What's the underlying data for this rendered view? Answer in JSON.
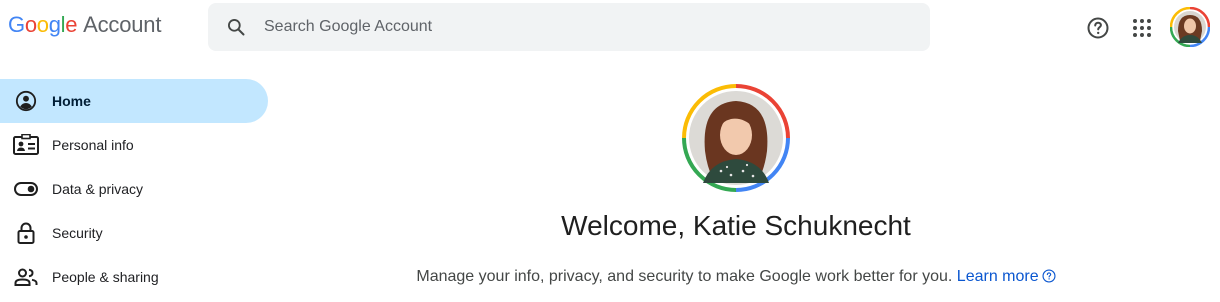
{
  "header": {
    "logo_brand": "Google",
    "logo_product": "Account",
    "search_placeholder": "Search Google Account",
    "icons": [
      "search-icon",
      "help-icon",
      "apps-icon"
    ]
  },
  "sidebar": {
    "items": [
      {
        "label": "Home",
        "icon": "home-icon",
        "active": true
      },
      {
        "label": "Personal info",
        "icon": "id-card-icon",
        "active": false
      },
      {
        "label": "Data & privacy",
        "icon": "toggle-icon",
        "active": false
      },
      {
        "label": "Security",
        "icon": "lock-icon",
        "active": false
      },
      {
        "label": "People & sharing",
        "icon": "people-icon",
        "active": false
      }
    ]
  },
  "main": {
    "welcome": "Welcome, Katie Schuknecht",
    "subtitle": "Manage your info, privacy, and security to make Google work better for you.",
    "learn_more": "Learn more"
  },
  "colors": {
    "active_bg": "#c2e7ff",
    "link": "#0b57d0",
    "google_blue": "#4285f4",
    "google_red": "#ea4335",
    "google_yellow": "#fbbc05",
    "google_green": "#34a853"
  }
}
